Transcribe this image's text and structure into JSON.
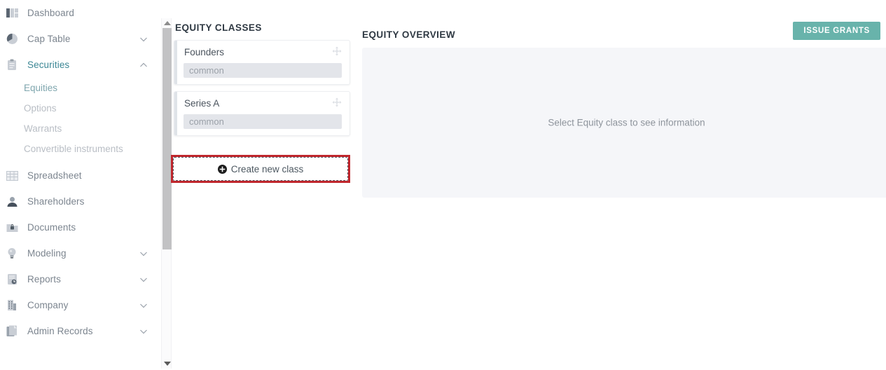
{
  "colors": {
    "accent_teal": "#3c8795",
    "button_teal": "#68b3ab",
    "highlight_red": "#c0272d",
    "panel_bg": "#f5f6f9",
    "pill_bg": "#e3e5ea",
    "muted_text": "#b9bec5"
  },
  "sidebar": {
    "items": [
      {
        "label": "Dashboard",
        "icon": "bar-chart-icon",
        "chevron": "none",
        "state": "default"
      },
      {
        "label": "Cap Table",
        "icon": "pie-chart-icon",
        "chevron": "down",
        "state": "default"
      },
      {
        "label": "Securities",
        "icon": "clipboard-icon",
        "chevron": "up",
        "state": "active"
      },
      {
        "label": "Spreadsheet",
        "icon": "table-grid-icon",
        "chevron": "none",
        "state": "default"
      },
      {
        "label": "Shareholders",
        "icon": "person-icon",
        "chevron": "none",
        "state": "default"
      },
      {
        "label": "Documents",
        "icon": "folder-lock-icon",
        "chevron": "none",
        "state": "default"
      },
      {
        "label": "Modeling",
        "icon": "lightbulb-icon",
        "chevron": "down",
        "state": "default"
      },
      {
        "label": "Reports",
        "icon": "report-icon",
        "chevron": "down",
        "state": "default"
      },
      {
        "label": "Company",
        "icon": "building-icon",
        "chevron": "down",
        "state": "default"
      },
      {
        "label": "Admin Records",
        "icon": "documents-icon",
        "chevron": "down",
        "state": "default"
      }
    ],
    "securities_subitems": [
      {
        "label": "Equities",
        "state": "active"
      },
      {
        "label": "Options",
        "state": "default"
      },
      {
        "label": "Warrants",
        "state": "default"
      },
      {
        "label": "Convertible instruments",
        "state": "default"
      }
    ]
  },
  "scrollbar": {
    "up_arrow": "triangle-up-icon",
    "down_arrow": "triangle-down-icon"
  },
  "equity_classes": {
    "title": "EQUITY CLASSES",
    "cards": [
      {
        "name": "Founders",
        "type": "common",
        "handle": "move-handle-icon"
      },
      {
        "name": "Series A",
        "type": "common",
        "handle": "move-handle-icon"
      }
    ],
    "create_button": {
      "label": "Create new class",
      "icon": "plus-circle-icon",
      "highlighted": true
    }
  },
  "equity_overview": {
    "title": "EQUITY OVERVIEW",
    "empty_message": "Select Equity class to see information"
  },
  "toolbar": {
    "issue_grants_label": "ISSUE GRANTS"
  }
}
